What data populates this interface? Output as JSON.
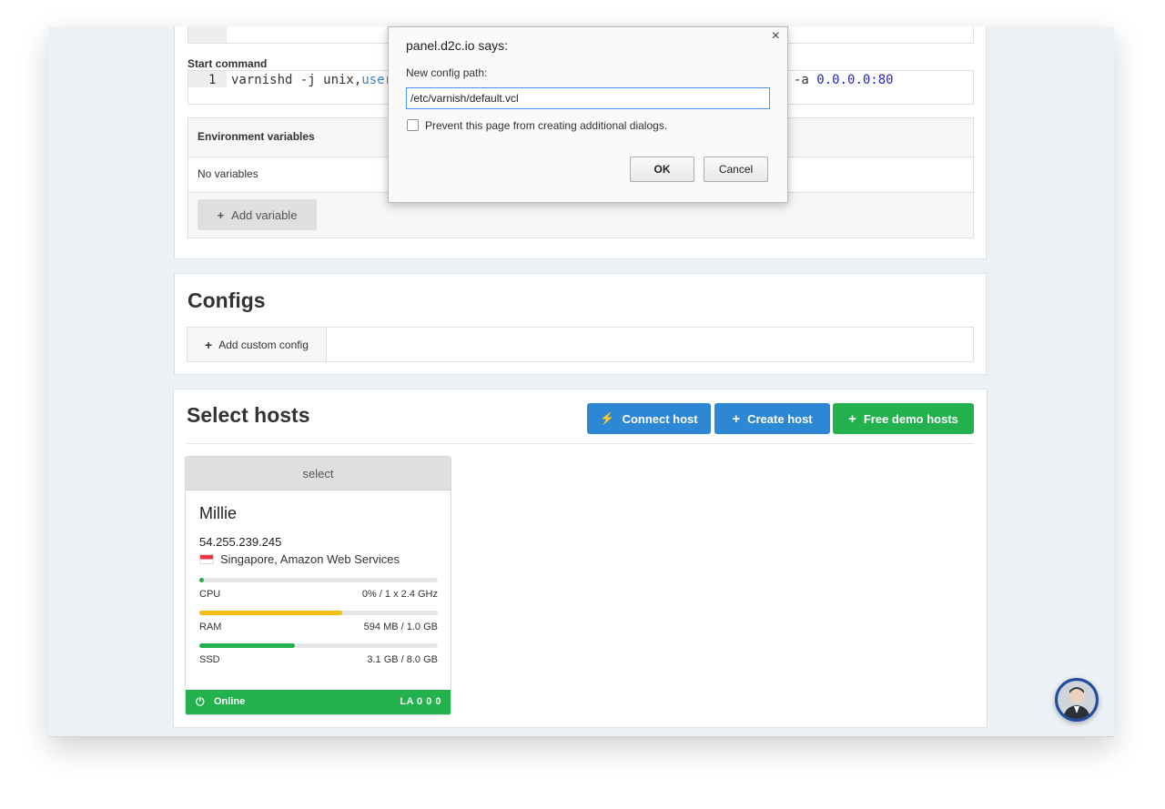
{
  "start_command": {
    "label": "Start command",
    "line_number": "1",
    "code_prefix": "varnishd -j unix,",
    "code_keyword": "user",
    "code_suffix_flag": "-a ",
    "code_suffix_value": "0.0.0.0:80"
  },
  "env": {
    "title": "Environment variables",
    "empty_text": "No variables",
    "add_button": "Add variable"
  },
  "configs": {
    "title": "Configs",
    "add_button": "Add custom config"
  },
  "hosts": {
    "title": "Select hosts",
    "buttons": {
      "connect": "Connect host",
      "create": "Create host",
      "demo": "Free demo hosts"
    },
    "card": {
      "select_label": "select",
      "name": "Millie",
      "ip": "54.255.239.245",
      "location": "Singapore, Amazon Web Services",
      "metrics": [
        {
          "label": "CPU",
          "value": "0% / 1 x 2.4 GHz",
          "fill": 0.02,
          "color": "#22b14c"
        },
        {
          "label": "RAM",
          "value": "594 MB / 1.0 GB",
          "fill": 0.6,
          "color": "#f4bd17"
        },
        {
          "label": "SSD",
          "value": "3.1 GB / 8.0 GB",
          "fill": 0.4,
          "color": "#22b14c"
        }
      ],
      "status": "Online",
      "load": "LA 0 0 0"
    }
  },
  "dialog": {
    "title": "panel.d2c.io says:",
    "prompt": "New config path:",
    "input_value": "/etc/varnish/default.vcl",
    "checkbox_label": "Prevent this page from creating additional dialogs.",
    "ok": "OK",
    "cancel": "Cancel",
    "close": "×"
  },
  "colors": {
    "blue": "#2c87d4",
    "green": "#22b14c",
    "yellow": "#f4bd17"
  }
}
